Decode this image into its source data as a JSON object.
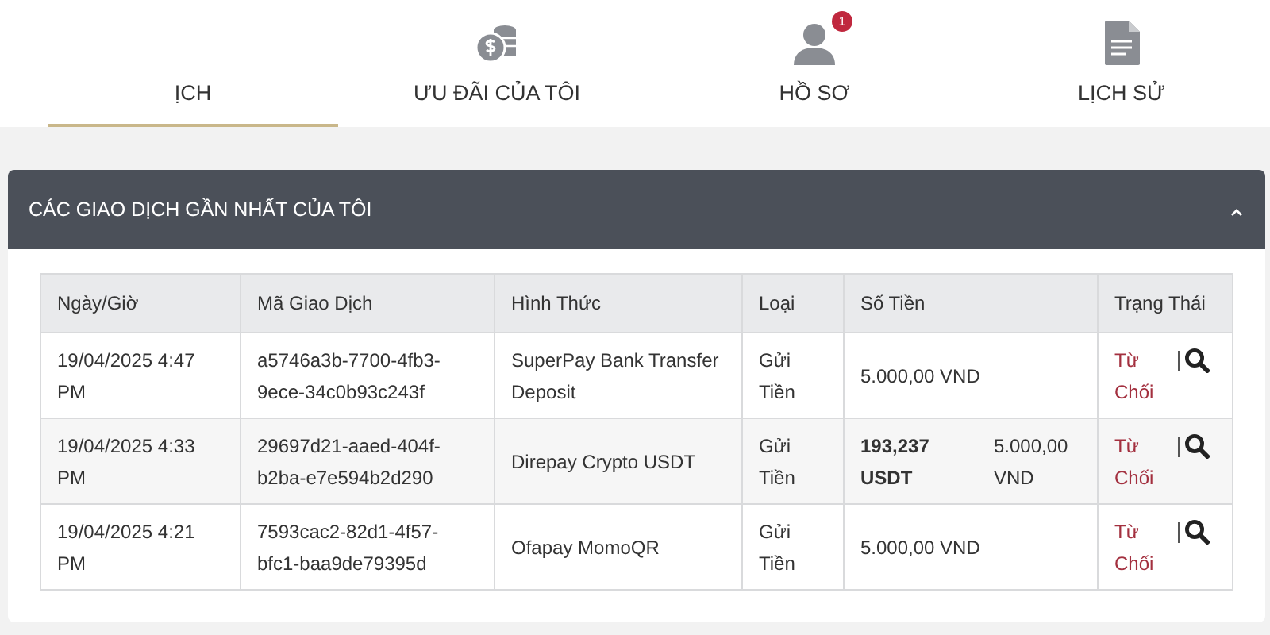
{
  "tabs": [
    {
      "label": "ỊCH",
      "kind": "transactions",
      "selected": true
    },
    {
      "label": "ƯU ĐÃI CỦA TÔI",
      "kind": "offers",
      "selected": false
    },
    {
      "label": "HỒ SƠ",
      "kind": "profile",
      "selected": false,
      "badge": "1"
    },
    {
      "label": "LỊCH SỬ",
      "kind": "history",
      "selected": false
    }
  ],
  "panel": {
    "title": "CÁC GIAO DỊCH GẦN NHẤT CỦA TÔI",
    "expanded": true,
    "table": {
      "columns": [
        "Ngày/Giờ",
        "Mã Giao Dịch",
        "Hình Thức",
        "Loại",
        "Số Tiền",
        "Trạng Thái"
      ],
      "rows": [
        {
          "date": "19/04/2025 4:47 PM",
          "id": "a5746a3b-7700-4fb3-9ece-34c0b93c243f",
          "method": "SuperPay Bank Transfer Deposit",
          "type": "Gửi Tiền",
          "amount": "5.000,00 VND",
          "status": {
            "label": "Từ Chối",
            "kind": "rejected"
          }
        },
        {
          "date": "19/04/2025 4:33 PM",
          "id": "29697d21-aaed-404f-b2ba-e7e594b2d290",
          "method": "Direpay Crypto USDT",
          "type": "Gửi Tiền",
          "amount_crypto": "193,237 USDT",
          "amount": "5.000,00 VND",
          "status": {
            "label": "Từ Chối",
            "kind": "rejected"
          }
        },
        {
          "date": "19/04/2025 4:21 PM",
          "id": "7593cac2-82d1-4f57-bfc1-baa9de79395d",
          "method": "Ofapay MomoQR",
          "type": "Gửi Tiền",
          "amount": "5.000,00 VND",
          "status": {
            "label": "Từ Chối",
            "kind": "rejected"
          }
        }
      ]
    }
  }
}
